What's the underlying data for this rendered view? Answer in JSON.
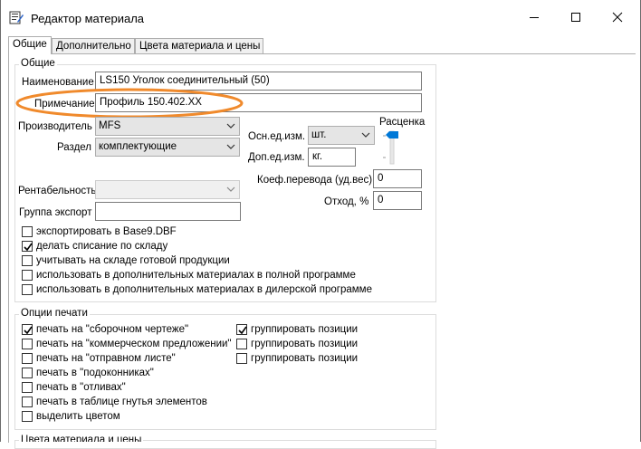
{
  "window": {
    "title": "Редактор материала",
    "minimize_icon": "minimize-icon",
    "maximize_icon": "maximize-icon",
    "close_icon": "close-icon"
  },
  "tabs": [
    {
      "label": "Общие",
      "active": true
    },
    {
      "label": "Дополнительно",
      "active": false
    },
    {
      "label": "Цвета материала и цены",
      "active": false
    }
  ],
  "general": {
    "group_title": "Общие",
    "name_label": "Наименование",
    "name_value": "LS150 Уголок соединительный (50)",
    "note_label": "Примечание",
    "note_value": "Профиль 150.402.XX",
    "manufacturer_label": "Производитель",
    "manufacturer_value": "MFS",
    "section_label": "Раздел",
    "section_value": "комплектующие",
    "profitability_label": "Рентабельность",
    "profitability_value": "",
    "export_group_label": "Группа экспорт",
    "export_group_value": "",
    "main_unit_label": "Осн.ед.изм.",
    "main_unit_value": "шт.",
    "extra_unit_label": "Доп.ед.изм.",
    "extra_unit_value": "кг.",
    "pricing_label": "Расценка",
    "conversion_label": "Коеф.перевода (уд.вес)",
    "conversion_value": "0",
    "waste_label": "Отход, %",
    "waste_value": "0",
    "checkboxes": [
      {
        "label": "экспортировать в Base9.DBF",
        "checked": false
      },
      {
        "label": "делать списание по складу",
        "checked": true
      },
      {
        "label": "учитывать на складе готовой продукции",
        "checked": false
      },
      {
        "label": "использовать в дополнительных материалах в полной программе",
        "checked": false
      },
      {
        "label": "использовать в дополнительных материалах в дилерской программе",
        "checked": false
      }
    ]
  },
  "print_options": {
    "group_title": "Опции печати",
    "left": [
      {
        "label": "печать на \"сборочном чертеже\"",
        "checked": true
      },
      {
        "label": "печать на \"коммерческом предложении\"",
        "checked": false
      },
      {
        "label": "печать на \"отправном листе\"",
        "checked": false
      },
      {
        "label": "печать в \"подоконниках\"",
        "checked": false
      },
      {
        "label": "печать в \"отливах\"",
        "checked": false
      },
      {
        "label": "печать в таблице гнутья элементов",
        "checked": false
      },
      {
        "label": "выделить цветом",
        "checked": false
      }
    ],
    "right": [
      {
        "label": "группировать позиции",
        "checked": true
      },
      {
        "label": "группировать позиции",
        "checked": false
      },
      {
        "label": "группировать позиции",
        "checked": false
      }
    ]
  },
  "bottom_group_title": "Цвета материала и цены",
  "colors": {
    "highlight_ellipse": "#f08a2c",
    "slider_thumb": "#0078d7",
    "border": "#7a7a7a"
  }
}
